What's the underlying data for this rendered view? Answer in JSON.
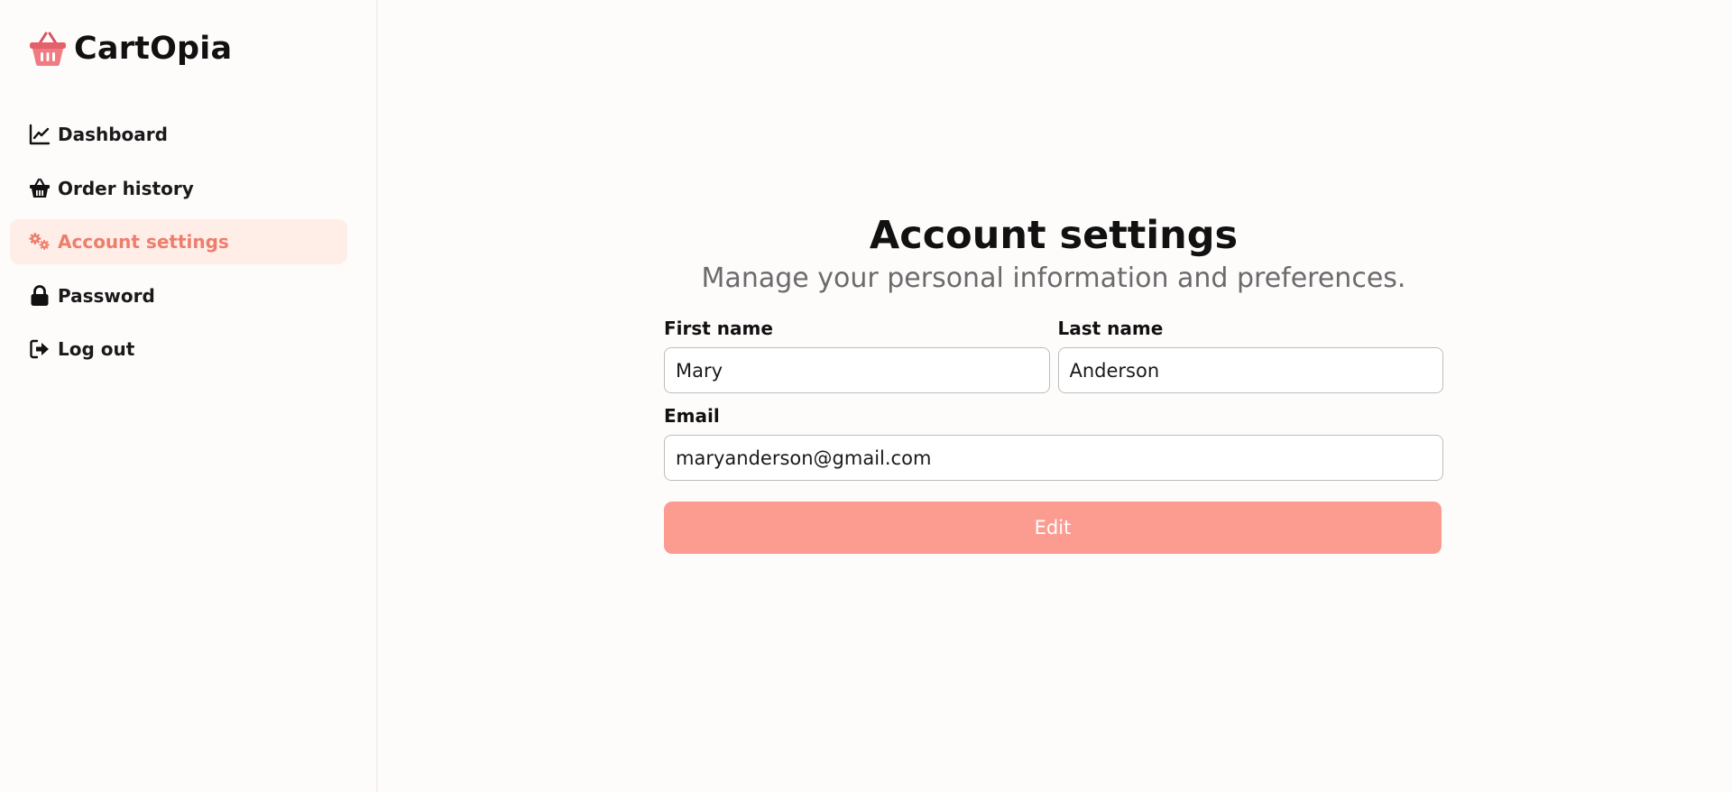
{
  "brand": {
    "name": "CartOpia",
    "icon": "basket-icon",
    "accent": "#e4606a"
  },
  "sidebar": {
    "items": [
      {
        "label": "Dashboard",
        "icon": "chart-line-icon",
        "active": false
      },
      {
        "label": "Order history",
        "icon": "basket-icon",
        "active": false
      },
      {
        "label": "Account settings",
        "icon": "gears-icon",
        "active": true
      },
      {
        "label": "Password",
        "icon": "lock-icon",
        "active": false
      },
      {
        "label": "Log out",
        "icon": "logout-icon",
        "active": false
      }
    ],
    "active_bg": "#ffede8",
    "active_color": "#ee7e6c"
  },
  "main": {
    "title": "Account settings",
    "subtitle": "Manage your personal information and preferences.",
    "form": {
      "first_name_label": "First name",
      "first_name_value": "Mary",
      "last_name_label": "Last name",
      "last_name_value": "Anderson",
      "email_label": "Email",
      "email_value": "maryanderson@gmail.com",
      "edit_label": "Edit"
    },
    "button_color": "#fc9c90"
  }
}
